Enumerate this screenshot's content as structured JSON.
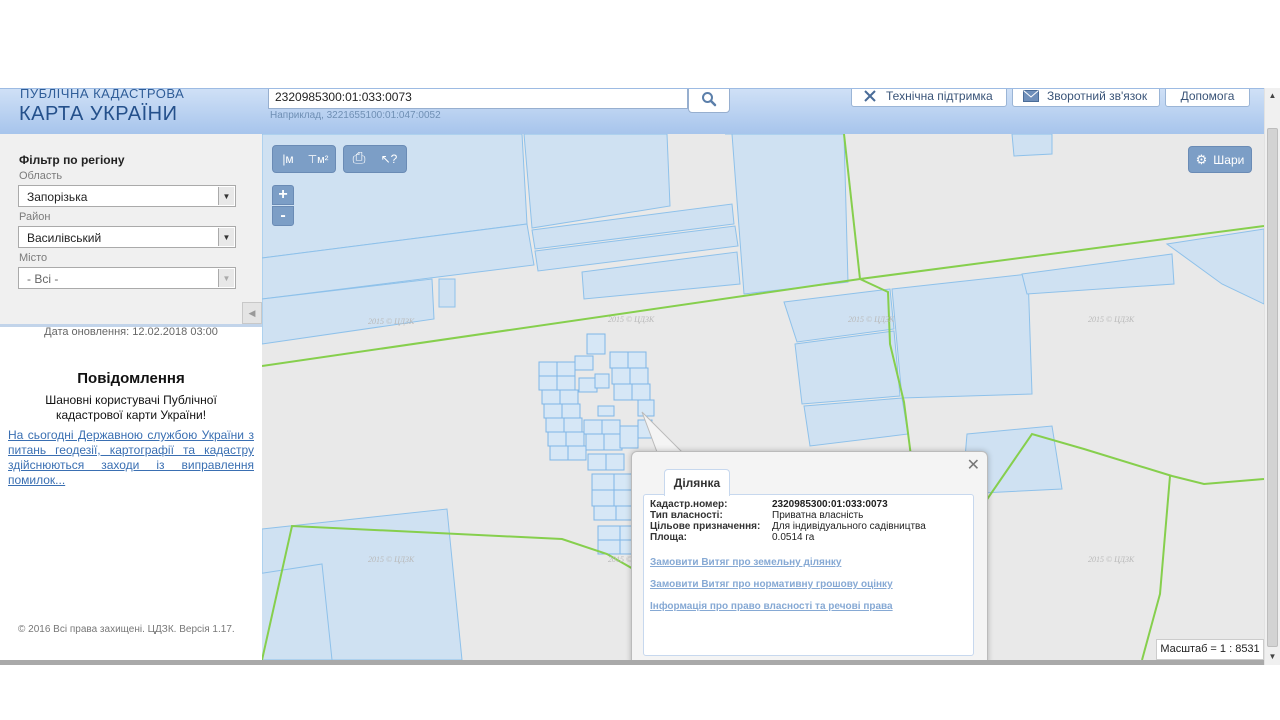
{
  "header": {
    "logo_line1": "ПУБЛІЧНА КАДАСТРОВА",
    "logo_line2": "КАРТА УКРАЇНИ",
    "search_value": "2320985300:01:033:0073",
    "search_hint": "Наприклад, 3221655100:01:047:0052",
    "support_label": "Технічна підтримка",
    "feedback_label": "Зворотний зв'язок",
    "help_label": "Допомога",
    "accent_color": "#a6c4ec"
  },
  "filter": {
    "title": "Фільтр по регіону",
    "oblast_label": "Область",
    "oblast_value": "Запорізька",
    "raion_label": "Район",
    "raion_value": "Василівський",
    "city_label": "Місто",
    "city_value": "- Всі -"
  },
  "panel": {
    "update_date": "Дата оновлення: 12.02.2018 03:00",
    "notice_title": "Повідомлення",
    "notice_text": "Шановні користувачі Публічної кадастрової карти України!",
    "notice_link": "На сьогодні Державною службою України з питань геодезії, картографії та кадастру здійснюються заходи із виправлення помилок...",
    "copyright": "© 2016 Всі права захищені. ЦДЗК. Версія 1.17."
  },
  "map": {
    "toolbar": [
      {
        "name": "measure-length-icon",
        "glyph": "|м"
      },
      {
        "name": "measure-area-icon",
        "glyph": "⊤м²"
      },
      {
        "name": "print-icon",
        "glyph": "⎙"
      },
      {
        "name": "identify-icon",
        "glyph": "↖?"
      }
    ],
    "zoom_in": "+",
    "zoom_out": "-",
    "layers_label": "Шари",
    "scale_text": "Масштаб = 1 : 8531",
    "watermark": "2015 © ЦДЗК",
    "parcel_color": "#cfe1f2",
    "parcel_border": "#8ec1ea",
    "boundary_color": "#86cf4d"
  },
  "popup": {
    "tab_label": "Ділянка",
    "rows": [
      {
        "label": "Кадастр.номер:",
        "value": "2320985300:01:033:0073"
      },
      {
        "label": "Тип власності:",
        "value": "Приватна власність"
      },
      {
        "label": "Цільове призначення:",
        "value": "Для індивідуального садівництва"
      },
      {
        "label": "Площа:",
        "value": "0.0514 га"
      }
    ],
    "links": [
      "Замовити Витяг про земельну ділянку",
      "Замовити Витяг про нормативну грошову оцінку",
      "Інформація про право власності та речові права"
    ]
  }
}
